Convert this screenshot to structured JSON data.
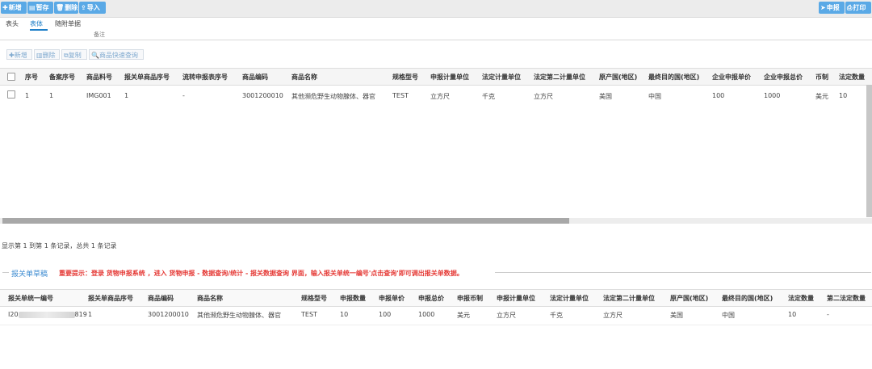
{
  "toolbar": {
    "add": "新增",
    "save_draft": "暂存",
    "delete": "删除",
    "import": "导入",
    "declare": "申报",
    "print": "打印"
  },
  "tabs": [
    "表头",
    "表体",
    "随附单据"
  ],
  "header_fragment": "备注",
  "body_toolbar": {
    "add": "新增",
    "delete": "删除",
    "copy": "复制",
    "quick_query": "商品快速查询"
  },
  "grid1": {
    "headers": [
      "序号",
      "备案序号",
      "商品料号",
      "报关单商品序号",
      "流转申报表序号",
      "商品编码",
      "商品名称",
      "规格型号",
      "申报计量单位",
      "法定计量单位",
      "法定第二计量单位",
      "原产国(地区)",
      "最终目的国(地区)",
      "企业申报单价",
      "企业申报总价",
      "币制",
      "法定数量"
    ],
    "rows": [
      [
        "1",
        "1",
        "IMG001",
        "1",
        "-",
        "3001200010",
        "其他濒危野生动物腺体、器官",
        "TEST",
        "立方尺",
        "千克",
        "立方尺",
        "美国",
        "中国",
        "100",
        "1000",
        "美元",
        "10"
      ]
    ]
  },
  "pager": "显示第 1 到第 1 条记录，总共 1 条记录",
  "draft": {
    "title": "报关单草稿",
    "notice": "重要提示：登录 货物申报系统 ，进入 货物申报 - 数据查询/统计 - 报关数据查询 界面，输入报关单统一编号'点击查询'即可调出报关单数据。",
    "headers": [
      "报关单统一编号",
      "报关单商品序号",
      "商品编码",
      "商品名称",
      "规格型号",
      "申报数量",
      "申报单价",
      "申报总价",
      "申报币制",
      "申报计量单位",
      "法定计量单位",
      "法定第二计量单位",
      "原产国(地区)",
      "最终目的国(地区)",
      "法定数量",
      "第二法定数量"
    ],
    "rows": [
      [
        "I20",
        "1",
        "3001200010",
        "其他濒危野生动物腺体、器官",
        "TEST",
        "10",
        "100",
        "1000",
        "美元",
        "立方尺",
        "千克",
        "立方尺",
        "美国",
        "中国",
        "10",
        "-"
      ]
    ],
    "row_id_tail": "819"
  },
  "colors": {
    "button": "#5aa9e6",
    "accent": "#1e7fc8",
    "notice": "#e53935"
  }
}
